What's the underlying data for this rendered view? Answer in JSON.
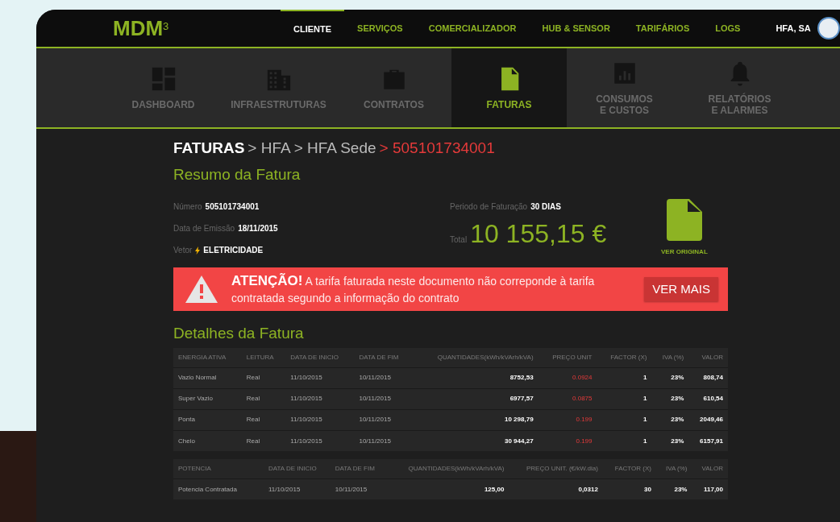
{
  "brand": {
    "name": "MDM",
    "sup": "3"
  },
  "top_nav": [
    {
      "label": "CLIENTE",
      "selected": true
    },
    {
      "label": "SERVIÇOS",
      "selected": false
    },
    {
      "label": "COMERCIALIZADOR",
      "selected": false
    },
    {
      "label": "HUB & SENSOR",
      "selected": false
    },
    {
      "label": "TARIFÁRIOS",
      "selected": false
    },
    {
      "label": "LOGS",
      "selected": false
    }
  ],
  "user": {
    "name": "HFA, SA"
  },
  "sections": [
    {
      "label": "DASHBOARD",
      "kind": "dashboard",
      "selected": false
    },
    {
      "label": "INFRAESTRUTURAS",
      "kind": "building",
      "selected": false
    },
    {
      "label": "CONTRATOS",
      "kind": "briefcase",
      "selected": false
    },
    {
      "label": "FATURAS",
      "kind": "file",
      "selected": true
    },
    {
      "label": "CONSUMOS\nE CUSTOS",
      "kind": "chart",
      "selected": false
    },
    {
      "label": "RELATÓRIOS\nE ALARMES",
      "kind": "bell",
      "selected": false
    }
  ],
  "breadcrumb": [
    {
      "label": "FATURAS",
      "kind": "root"
    },
    {
      "label": "> HFA",
      "kind": "mid"
    },
    {
      "label": "> HFA Sede",
      "kind": "mid"
    },
    {
      "label": "> 505101734001",
      "kind": "current"
    }
  ],
  "summary": {
    "title": "Resumo da Fatura",
    "fields": [
      {
        "label": "Número",
        "value": "505101734001"
      },
      {
        "label": "Data de Emissão",
        "value": "18/11/2015"
      },
      {
        "label": "Vetor",
        "value": "ELETRICIDADE"
      }
    ],
    "period_label": "Periodo de Faturação",
    "period_value": "30 DIAS",
    "total_label": "Total",
    "total": "10 155,15 €",
    "original_label": "VER ORIGINAL"
  },
  "alert": {
    "title": "ATENÇÃO!",
    "text": "A tarifa faturada neste documento não correponde à tarifa contratada segundo a informação do contrato",
    "button": "VER MAIS"
  },
  "details_title": "Detalhes da Fatura",
  "tables": [
    {
      "columns": [
        "ENERGIA ATIVA",
        "LEITURA",
        "DATA DE INICIO",
        "DATA DE FIM",
        "QUANTIDADES(kWh/kVArh/kVA)",
        "PREÇO UNIT",
        "FACTOR (X)",
        "IVA (%)",
        "VALOR"
      ],
      "rows": [
        {
          "cells": [
            "Vazio Normal",
            "Real",
            "11/10/2015",
            "10/11/2015",
            "8752,53",
            "0.0924",
            "1",
            "23%",
            "808,74"
          ],
          "flagged": true
        },
        {
          "cells": [
            "Super Vazio",
            "Real",
            "11/10/2015",
            "10/11/2015",
            "6977,57",
            "0.0875",
            "1",
            "23%",
            "610,54"
          ],
          "flagged": true
        },
        {
          "cells": [
            "Ponta",
            "Real",
            "11/10/2015",
            "10/11/2015",
            "10 298,79",
            "0.199",
            "1",
            "23%",
            "2049,46"
          ],
          "flagged": true
        },
        {
          "cells": [
            "Cheio",
            "Real",
            "11/10/2015",
            "10/11/2015",
            "30 944,27",
            "0.199",
            "1",
            "23%",
            "6157,91"
          ],
          "flagged": true
        }
      ]
    },
    {
      "columns": [
        "POTENCIA",
        "",
        "DATA DE INICIO",
        "DATA DE FIM",
        "QUANTIDADES(kWh/kVArh/kVA)",
        "PREÇO UNIT. (€/kW.dia)",
        "FACTOR (X)",
        "IVA (%)",
        "VALOR"
      ],
      "rows": [
        {
          "cells": [
            "Potencia Contratada",
            "",
            "11/10/2015",
            "10/11/2015",
            "125,00",
            "0,0312",
            "30",
            "23%",
            "117,00"
          ],
          "flagged": false
        }
      ]
    }
  ]
}
